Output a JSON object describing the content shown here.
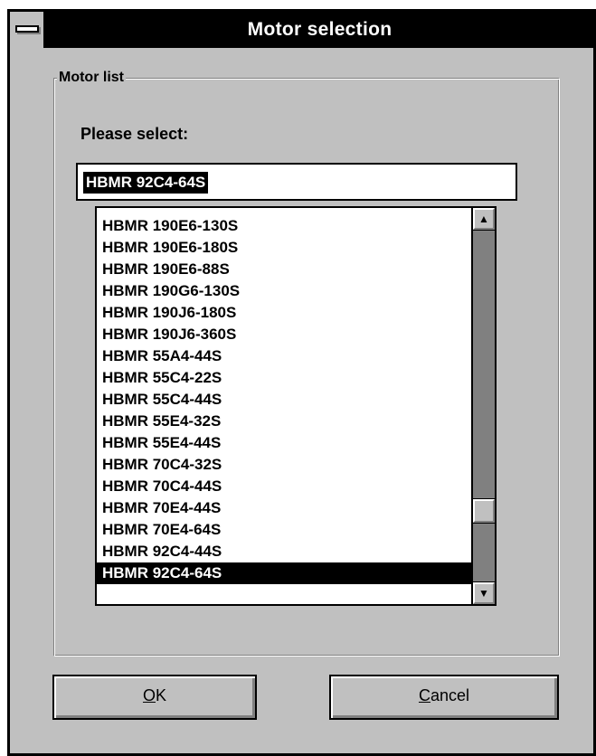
{
  "window": {
    "title": "Motor selection"
  },
  "groupbox": {
    "label": "Motor list"
  },
  "prompt": "Please select:",
  "combo": {
    "value": "HBMR 92C4-64S"
  },
  "list": {
    "items": [
      "HBMR 190E6-130S",
      "HBMR 190E6-180S",
      "HBMR 190E6-88S",
      "HBMR 190G6-130S",
      "HBMR 190J6-180S",
      "HBMR 190J6-360S",
      "HBMR 55A4-44S",
      "HBMR 55C4-22S",
      "HBMR 55C4-44S",
      "HBMR 55E4-32S",
      "HBMR 55E4-44S",
      "HBMR 70C4-32S",
      "HBMR 70C4-44S",
      "HBMR 70E4-44S",
      "HBMR 70E4-64S",
      "HBMR 92C4-44S",
      "HBMR 92C4-64S"
    ],
    "selected_index": 16
  },
  "scrollbar": {
    "up_icon": "arrow-up-icon",
    "down_icon": "arrow-down-icon",
    "position_fraction": 0.82
  },
  "buttons": {
    "ok": {
      "accel": "O",
      "rest": "K"
    },
    "cancel": {
      "accel": "C",
      "rest": "ancel"
    }
  }
}
